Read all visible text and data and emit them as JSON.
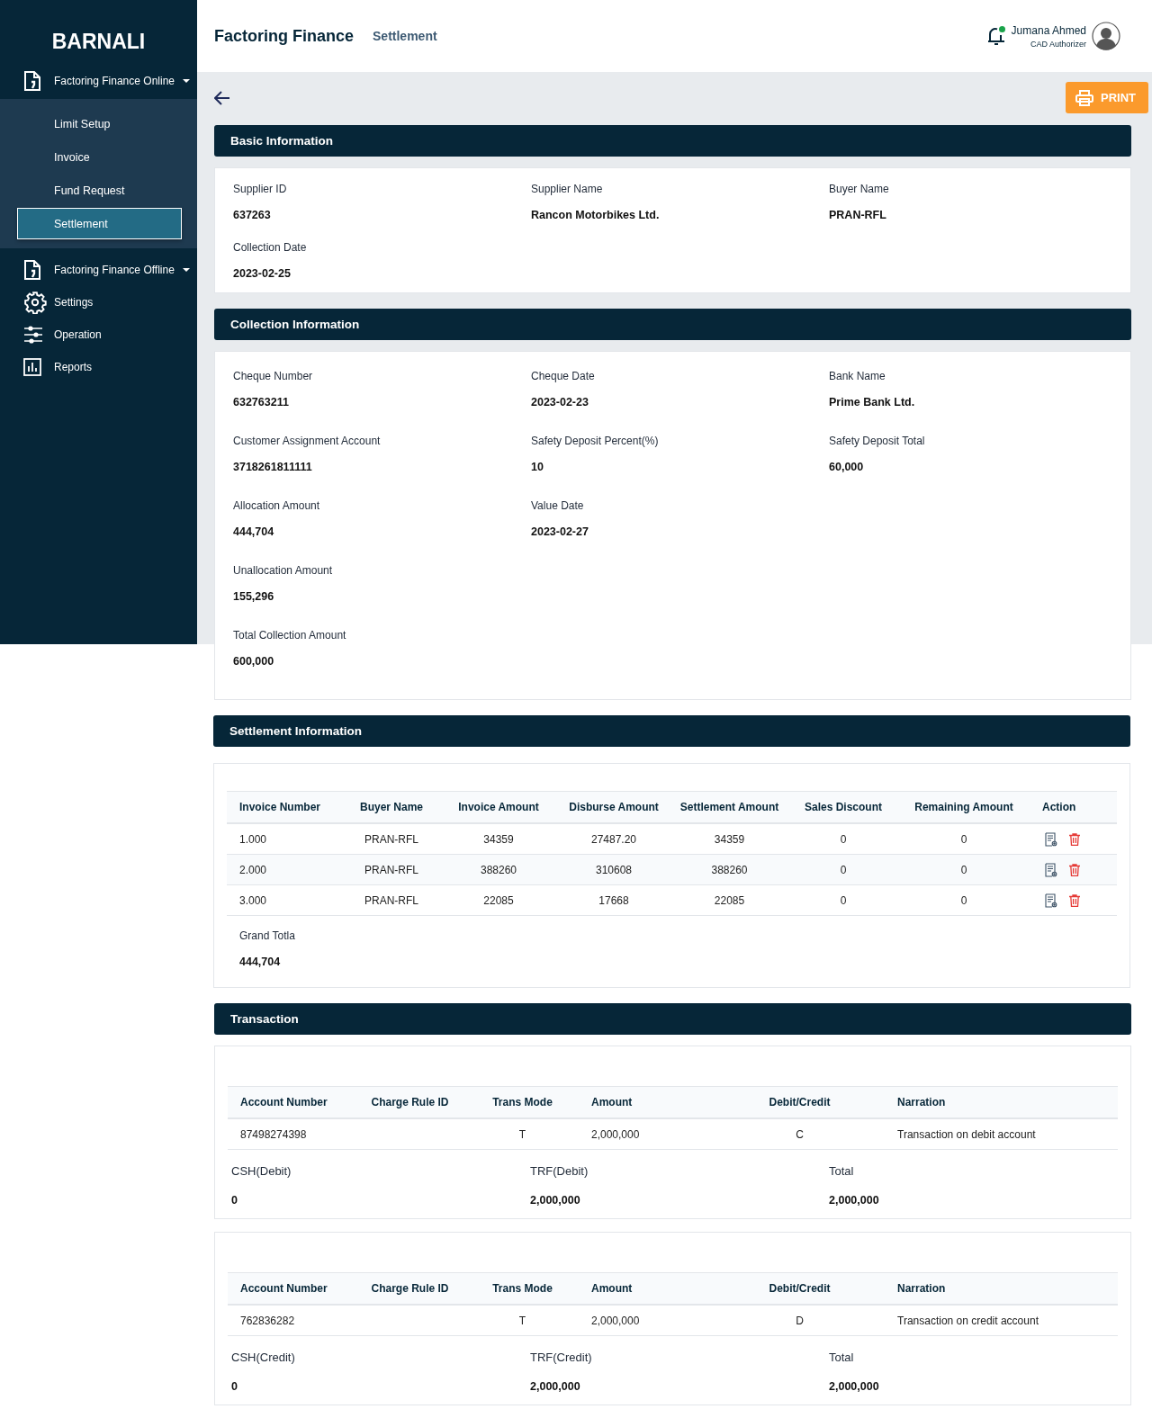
{
  "sidebar": {
    "brand": "BARNALI",
    "items": [
      {
        "label": "Factoring Finance Online",
        "dropdown": true,
        "children": [
          {
            "label": "Limit Setup",
            "selected": false
          },
          {
            "label": "Invoice",
            "selected": false
          },
          {
            "label": "Fund Request",
            "selected": false
          },
          {
            "label": "Settlement",
            "selected": true
          }
        ]
      },
      {
        "label": "Factoring Finance Offline",
        "dropdown": true
      },
      {
        "label": "Settings",
        "dropdown": false
      },
      {
        "label": "Operation",
        "dropdown": false
      },
      {
        "label": "Reports",
        "dropdown": false
      }
    ]
  },
  "header": {
    "title": "Factoring Finance",
    "subtitle": "Settlement",
    "notification": {
      "unread": true
    },
    "user": {
      "name": "Jumana Ahmed",
      "role": "CAD Authorizer"
    }
  },
  "toolbar": {
    "print_button": "PRINT"
  },
  "sections": [
    {
      "kind": "fields",
      "title": "Basic Information",
      "rows": [
        [
          {
            "label": "Supplier ID",
            "value": "637263"
          },
          {
            "label": "Supplier Name",
            "value": "Rancon Motorbikes Ltd."
          },
          {
            "label": "Buyer Name",
            "value": "PRAN-RFL"
          }
        ],
        [
          {
            "label": "Collection Date",
            "value": "2023-02-25"
          }
        ]
      ]
    },
    {
      "kind": "fields",
      "title": "Collection Information",
      "rows": [
        [
          {
            "label": "Cheque Number",
            "value": "632763211"
          },
          {
            "label": "Cheque Date",
            "value": "2023-02-23"
          },
          {
            "label": "Bank Name",
            "value": "Prime Bank Ltd."
          }
        ],
        [
          {
            "label": "Customer Assignment Account",
            "value": "3718261811111"
          },
          {
            "label": "Safety Deposit Percent(%)",
            "value": "10"
          },
          {
            "label": "Safety Deposit Total",
            "value": "60,000"
          }
        ],
        [
          {
            "label": "Allocation Amount",
            "value": "444,704"
          },
          {
            "label": "Value Date",
            "value": "2023-02-27"
          }
        ],
        [
          {
            "label": "Unallocation Amount",
            "value": "155,296"
          }
        ],
        [
          {
            "label": "Total Collection Amount",
            "value": "600,000"
          }
        ]
      ]
    },
    {
      "kind": "invoices",
      "title": "Settlement Information",
      "columns": [
        "Invoice Number",
        "Buyer Name",
        "Invoice Amount",
        "Disburse Amount",
        "Settlement Amount",
        "Sales Discount",
        "Remaining Amount",
        "Action"
      ],
      "rows": [
        [
          "1.000",
          "PRAN-RFL",
          "34359",
          "27487.20",
          "34359",
          "0",
          "0"
        ],
        [
          "2.000",
          "PRAN-RFL",
          "388260",
          "310608",
          "388260",
          "0",
          "0"
        ],
        [
          "3.000",
          "PRAN-RFL",
          "22085",
          "17668",
          "22085",
          "0",
          "0"
        ]
      ],
      "total": {
        "label": "Grand Totla",
        "value": "444,704"
      }
    },
    {
      "kind": "transactions",
      "title": "Transaction",
      "cards": [
        {
          "columns": [
            "Account Number",
            "Charge Rule ID",
            "Trans Mode",
            "Amount",
            "Debit/Credit",
            "Narration"
          ],
          "rows": [
            [
              "87498274398",
              "",
              "T",
              "2,000,000",
              "C",
              "Transaction on debit account"
            ]
          ],
          "totals": [
            {
              "label": "CSH(Debit)",
              "value": "0"
            },
            {
              "label": "TRF(Debit)",
              "value": "2,000,000"
            },
            {
              "label": "Total",
              "value": "2,000,000"
            }
          ]
        },
        {
          "columns": [
            "Account Number",
            "Charge Rule ID",
            "Trans Mode",
            "Amount",
            "Debit/Credit",
            "Narration"
          ],
          "rows": [
            [
              "762836282",
              "",
              "T",
              "2,000,000",
              "D",
              "Transaction on credit account"
            ]
          ],
          "totals": [
            {
              "label": "CSH(Credit)",
              "value": "0"
            },
            {
              "label": "TRF(Credit)",
              "value": "2,000,000"
            },
            {
              "label": "Total",
              "value": "2,000,000"
            }
          ]
        }
      ]
    }
  ]
}
